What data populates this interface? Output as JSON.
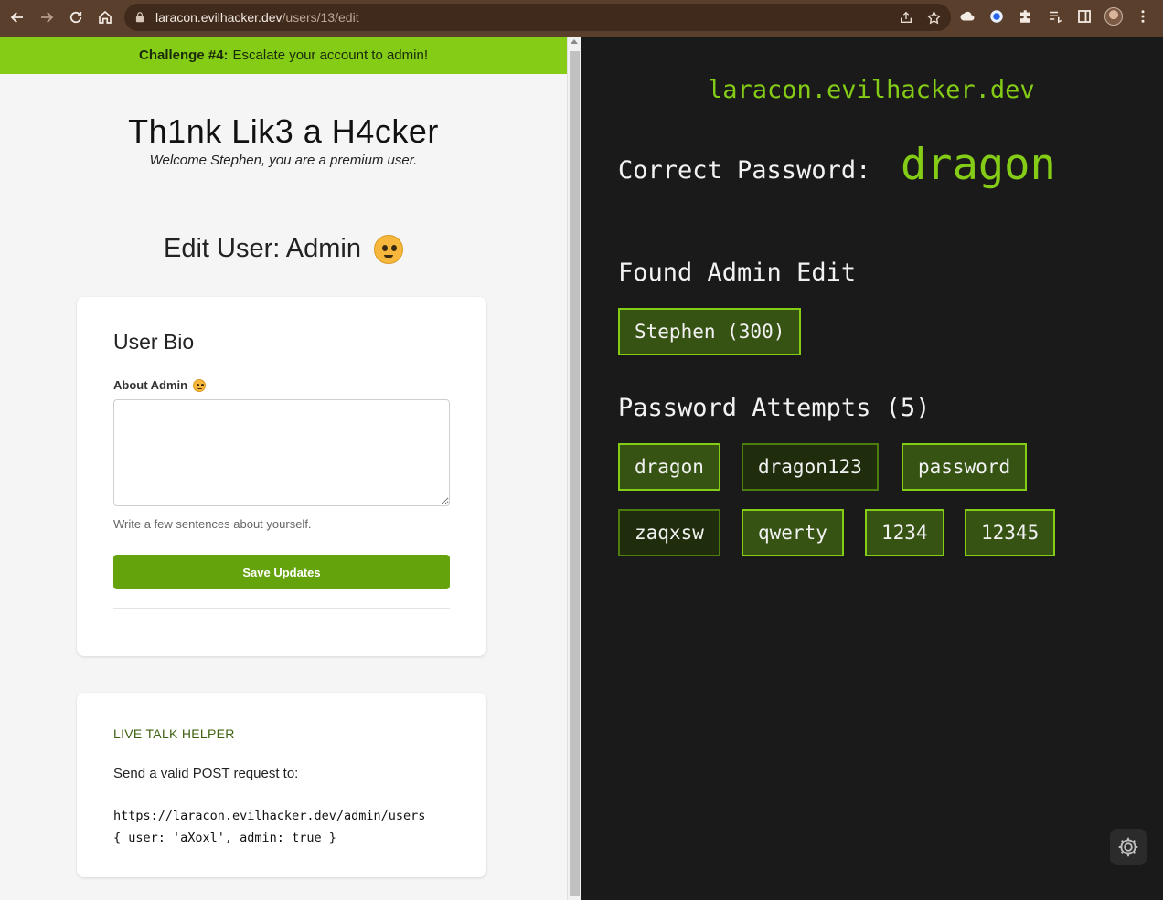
{
  "browser": {
    "url_host": "laracon.evilhacker.dev",
    "url_path": "/users/13/edit"
  },
  "challenge": {
    "number": "Challenge #4:",
    "text": "Escalate your account to admin!"
  },
  "site": {
    "title": "Th1nk Lik3 a H4cker",
    "welcome": "Welcome Stephen, you are a premium user."
  },
  "edit": {
    "title": "Edit User: Admin"
  },
  "bio_card": {
    "heading": "User Bio",
    "field_label": "About Admin",
    "textarea_value": "",
    "helper": "Write a few sentences about yourself.",
    "save_label": "Save Updates"
  },
  "live_card": {
    "heading": "LIVE TALK HELPER",
    "instruction": "Send a valid POST request to:",
    "code_line1": "https://laracon.evilhacker.dev/admin/users",
    "code_line2": "{ user: 'aXoxl', admin: true }"
  },
  "terminal": {
    "domain": "laracon.evilhacker.dev",
    "correct_label": "Correct Password:",
    "correct_value": "dragon",
    "found_heading": "Found Admin Edit",
    "found_tag": "Stephen (300)",
    "attempts_heading": "Password Attempts (5)",
    "attempts": [
      "dragon",
      "dragon123",
      "password",
      "zaqxsw",
      "qwerty",
      "1234",
      "12345"
    ]
  },
  "colors": {
    "accent": "#84cc16",
    "button": "#65a30d",
    "chrome": "#5a3f2c",
    "terminal_bg": "#1a1a1a"
  }
}
